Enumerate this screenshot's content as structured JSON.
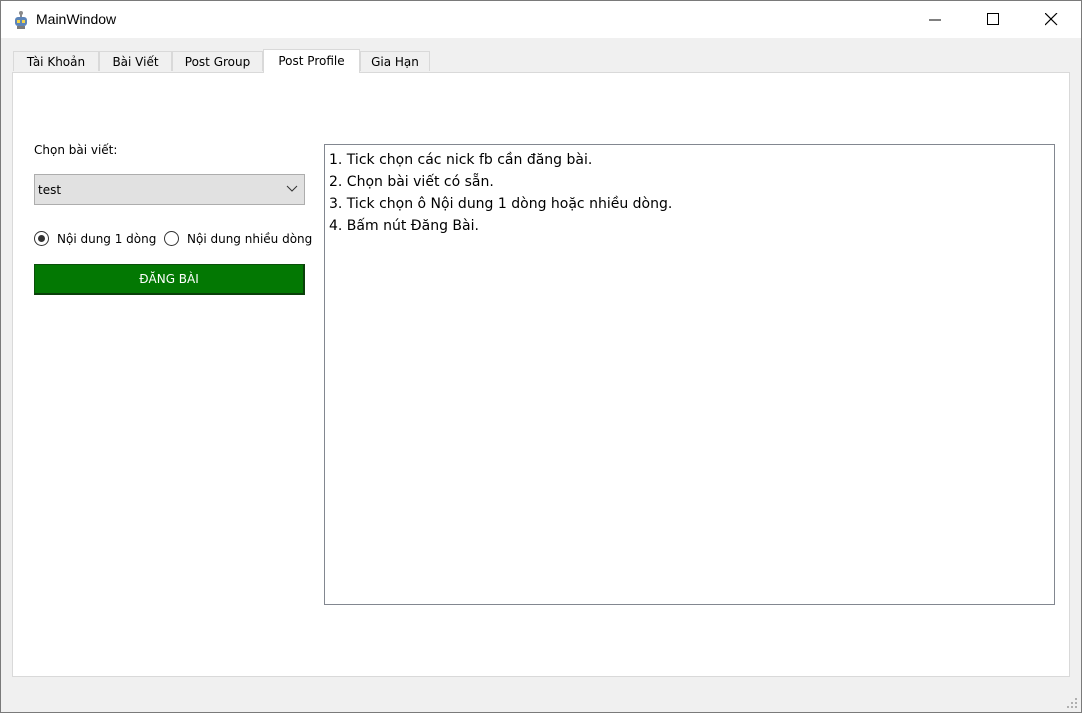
{
  "window": {
    "title": "MainWindow",
    "icon": "python-robot-icon"
  },
  "tabs": [
    {
      "label": "Tài Khoản",
      "active": false
    },
    {
      "label": "Bài Viết",
      "active": false
    },
    {
      "label": "Post Group",
      "active": false
    },
    {
      "label": "Post Profile",
      "active": true
    },
    {
      "label": "Gia Hạn",
      "active": false
    }
  ],
  "form": {
    "choose_label": "Chọn bài viết:",
    "combo_value": "test",
    "radio_single": {
      "label": "Nội dung 1 dòng",
      "checked": true
    },
    "radio_multi": {
      "label": "Nội dung nhiều dòng",
      "checked": false
    },
    "post_button": "ĐĂNG BÀI",
    "post_button_color": "#037803"
  },
  "instructions": [
    "1. Tick chọn các nick fb cần đăng bài.",
    "2. Chọn bài viết có sẵn.",
    "3. Tick chọn ô Nội dung 1 dòng hoặc nhiều dòng.",
    "4. Bấm nút Đăng Bài."
  ]
}
